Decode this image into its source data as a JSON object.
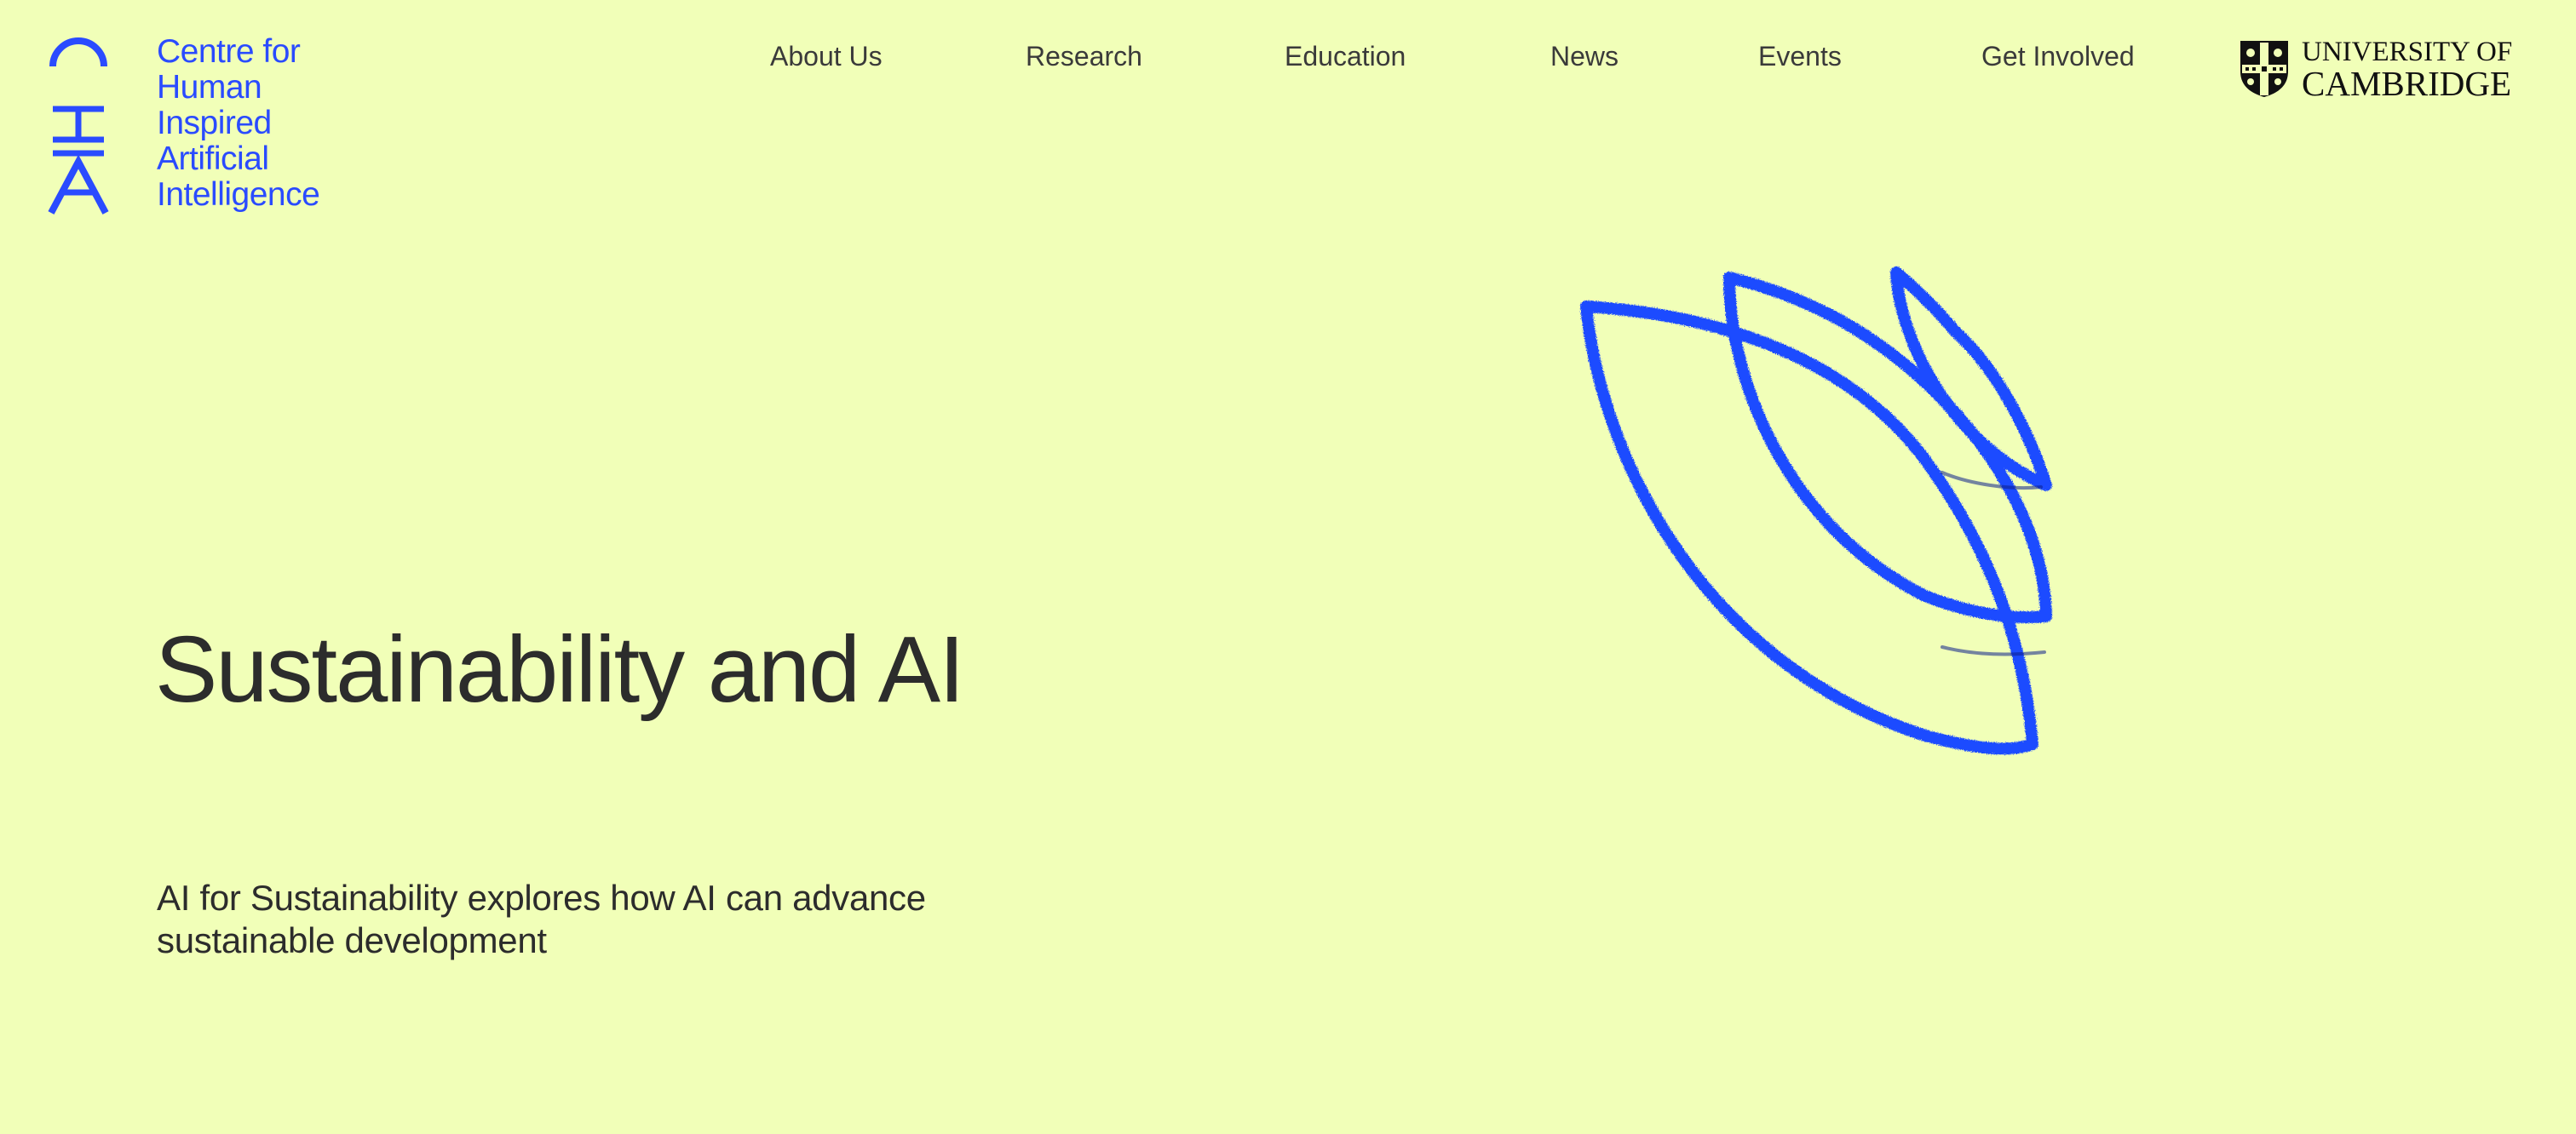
{
  "brand": {
    "monogram": "CHIA",
    "name_lines": [
      "Centre for",
      "Human",
      "Inspired",
      "Artificial",
      "Intelligence"
    ],
    "color": "#2a4bff"
  },
  "nav": {
    "items": [
      {
        "label": "About Us"
      },
      {
        "label": "Research"
      },
      {
        "label": "Education"
      },
      {
        "label": "News"
      },
      {
        "label": "Events"
      },
      {
        "label": "Get Involved"
      }
    ]
  },
  "partner": {
    "line1": "UNIVERSITY OF",
    "line2": "CAMBRIDGE",
    "icon": "university-shield-icon"
  },
  "hero": {
    "title": "Sustainability and AI",
    "subtitle": "AI for Sustainability explores how AI can advance sustainable development",
    "illustration_icon": "leaves-sketch-icon"
  },
  "colors": {
    "background": "#f1ffb8",
    "accent": "#2a4bff",
    "text": "#2c2c2c"
  }
}
